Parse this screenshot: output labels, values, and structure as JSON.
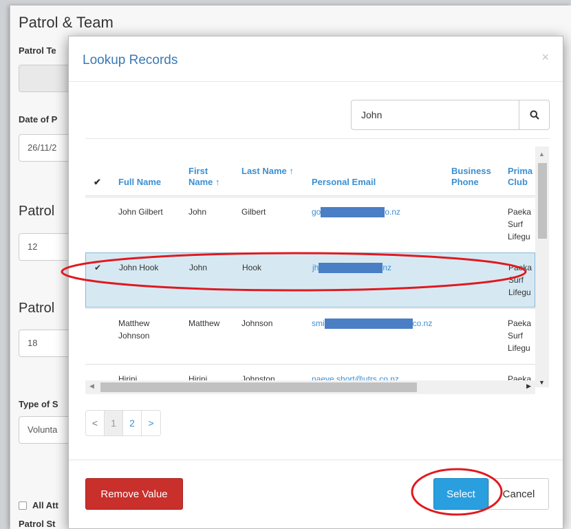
{
  "background_form": {
    "title": "Patrol & Team",
    "patrol_team_label": "Patrol Te",
    "date_label": "Date of P",
    "date_value": "26/11/2",
    "section_patrol_1": "Patrol",
    "field_value_1": "12",
    "section_patrol_2": "Patrol",
    "field_value_2": "18",
    "type_label": "Type of S",
    "type_value": "Volunta",
    "all_attendees_label": "All Att",
    "patrol_status_label": "Patrol St"
  },
  "modal": {
    "title": "Lookup Records",
    "close_glyph": "×",
    "search": {
      "value": "John",
      "icon": "search-icon"
    },
    "columns": {
      "check": "✔",
      "full_name": "Full Name",
      "first_name": "First Name ↑",
      "last_name": "Last Name ↑",
      "personal_email": "Personal Email",
      "business_phone": "Business Phone",
      "primary_club": "Prima Club"
    },
    "rows": [
      {
        "check": "",
        "full_name": "John Gilbert",
        "first_name": "John",
        "last_name": "Gilbert",
        "email_start": "go",
        "email_end": "o.nz",
        "business_phone": "",
        "club": "Paeka Surf Lifegu"
      },
      {
        "check": "✔",
        "full_name": "John Hook",
        "first_name": "John",
        "last_name": "Hook",
        "email_start": "jh",
        "email_end": "nz",
        "business_phone": "",
        "club": "Paeka Surf Lifegu"
      },
      {
        "check": "",
        "full_name": "Matthew Johnson",
        "first_name": "Matthew",
        "last_name": "Johnson",
        "email_start": "smi",
        "email_end": "co.nz",
        "business_phone": "",
        "club": "Paeka Surf Lifegu"
      },
      {
        "check": "",
        "full_name": "Hirini",
        "first_name": "Hirini",
        "last_name": "Johnston",
        "email_start": "naeve.short@utrs.co.nz",
        "email_end": "",
        "business_phone": "",
        "club": "Paeka"
      }
    ],
    "pager": {
      "prev": "<",
      "pages": [
        "1",
        "2"
      ],
      "next": ">"
    },
    "remove_label": "Remove Value",
    "select_label": "Select",
    "cancel_label": "Cancel"
  },
  "colors": {
    "annotation": "#e0191e",
    "accent": "#3b8fd2",
    "danger": "#c9302c",
    "primary": "#2a9fe0"
  }
}
